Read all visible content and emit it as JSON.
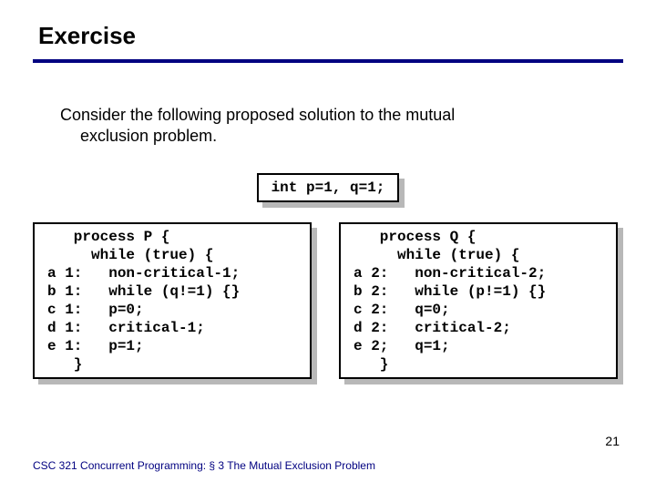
{
  "title": "Exercise",
  "intro_line1": "Consider the following proposed solution to the mutual",
  "intro_line2": "exclusion problem.",
  "decl": "int p=1, q=1;",
  "proc_p": "   process P {\n     while (true) {\na 1:   non-critical-1;\nb 1:   while (q!=1) {}\nc 1:   p=0;\nd 1:   critical-1;\ne 1:   p=1;\n   }",
  "proc_q": "   process Q {\n     while (true) {\na 2:   non-critical-2;\nb 2:   while (p!=1) {}\nc 2:   q=0;\nd 2:   critical-2;\ne 2;   q=1;\n   }",
  "footer": "CSC 321 Concurrent Programming: § 3 The Mutual Exclusion Problem",
  "pagenum": "21"
}
